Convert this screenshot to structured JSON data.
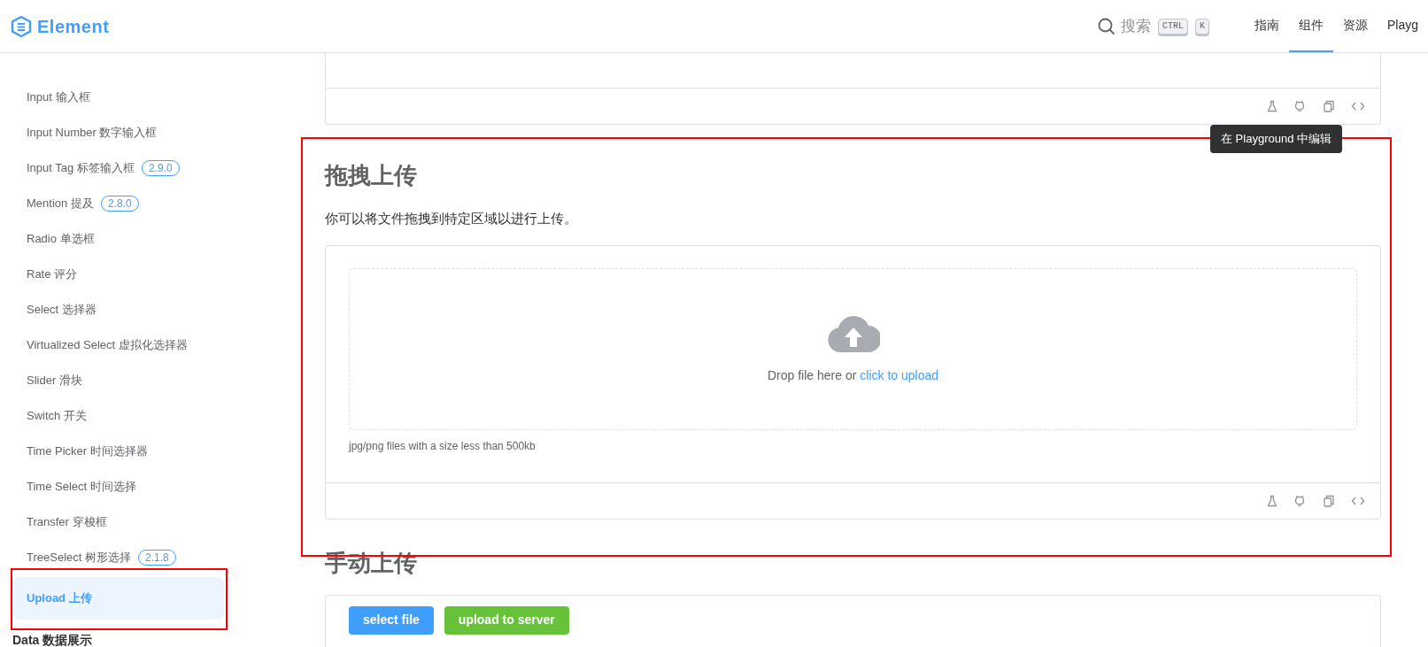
{
  "header": {
    "logo": "Element",
    "search": {
      "placeholder": "搜索",
      "keys": [
        "CTRL",
        "K"
      ]
    },
    "nav": [
      {
        "label": "指南",
        "selected": false
      },
      {
        "label": "组件",
        "selected": true
      },
      {
        "label": "资源",
        "selected": false
      },
      {
        "label": "Playg",
        "selected": false
      }
    ]
  },
  "sidebar": {
    "items": [
      {
        "label": "Input 输入框",
        "selected": false
      },
      {
        "label": "Input Number 数字输入框",
        "selected": false
      },
      {
        "label": "Input Tag 标签输入框",
        "badge": "2.9.0",
        "selected": false
      },
      {
        "label": "Mention 提及",
        "badge": "2.8.0",
        "selected": false
      },
      {
        "label": "Radio 单选框",
        "selected": false
      },
      {
        "label": "Rate 评分",
        "selected": false
      },
      {
        "label": "Select 选择器",
        "selected": false
      },
      {
        "label": "Virtualized Select 虚拟化选择器",
        "selected": false
      },
      {
        "label": "Slider 滑块",
        "selected": false
      },
      {
        "label": "Switch 开关",
        "selected": false
      },
      {
        "label": "Time Picker 时间选择器",
        "selected": false
      },
      {
        "label": "Time Select 时间选择",
        "selected": false
      },
      {
        "label": "Transfer 穿梭框",
        "selected": false
      },
      {
        "label": "TreeSelect 树形选择",
        "badge": "2.1.8",
        "selected": false
      },
      {
        "label": "Upload 上传",
        "selected": true
      }
    ],
    "group_title": "Data 数据展示"
  },
  "tooltip": "在 Playground 中编辑",
  "sections": [
    {
      "title": "拖拽上传",
      "description": "你可以将文件拖拽到特定区域以进行上传。",
      "demo": {
        "kind": "drag",
        "drop_text": "Drop file here or ",
        "drop_link": "click to upload",
        "tip": "jpg/png files with a size less than 500kb"
      }
    },
    {
      "title": "手动上传",
      "demo": {
        "kind": "manual",
        "buttons": [
          {
            "label": "select file",
            "color": "#409eff"
          },
          {
            "label": "upload to server",
            "color": "#67c23a"
          }
        ]
      }
    }
  ]
}
